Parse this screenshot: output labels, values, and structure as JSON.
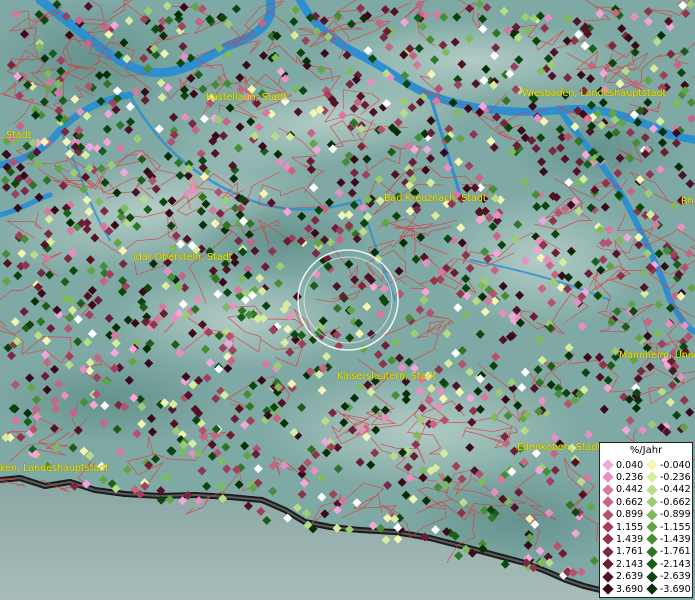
{
  "places": [
    {
      "name": "Kastellaun, Stadt",
      "pos": [
        206,
        92
      ]
    },
    {
      "name": "Wiesbaden, Landeshauptstadt",
      "pos": [
        522,
        88
      ]
    },
    {
      "name": ", Stadt",
      "pos": [
        0,
        130
      ]
    },
    {
      "name": "Bad Kreuznach, Stadt",
      "pos": [
        384,
        193
      ]
    },
    {
      "name": "Rh",
      "pos": [
        681,
        196
      ]
    },
    {
      "name": "Idar-Oberstein, Stadt",
      "pos": [
        133,
        252
      ]
    },
    {
      "name": "Mannheim, Univ",
      "pos": [
        619,
        350
      ]
    },
    {
      "name": "Kaiserslautern, Stadt",
      "pos": [
        337,
        371
      ]
    },
    {
      "name": "Edenkoben, Stadt",
      "pos": [
        517,
        442
      ]
    },
    {
      "name": "ken, Landeshauptstadt",
      "pos": [
        0,
        463
      ]
    }
  ],
  "legend": {
    "title": "%/Jahr",
    "positive": [
      {
        "value": "0.040",
        "color": "#f3a6d9"
      },
      {
        "value": "0.236",
        "color": "#e98ec0"
      },
      {
        "value": "0.442",
        "color": "#d8779f"
      },
      {
        "value": "0.662",
        "color": "#c86585"
      },
      {
        "value": "0.899",
        "color": "#b45270"
      },
      {
        "value": "1.155",
        "color": "#a0405d"
      },
      {
        "value": "1.439",
        "color": "#8e344d"
      },
      {
        "value": "1.761",
        "color": "#7a283f"
      },
      {
        "value": "2.143",
        "color": "#6a1d33"
      },
      {
        "value": "2.639",
        "color": "#521226"
      },
      {
        "value": "3.690",
        "color": "#3a0a1a"
      }
    ],
    "negative": [
      {
        "value": "-0.040",
        "color": "#f3f5b3"
      },
      {
        "value": "-0.236",
        "color": "#d6ec9e"
      },
      {
        "value": "-0.442",
        "color": "#b8dd88"
      },
      {
        "value": "-0.662",
        "color": "#9ccd73"
      },
      {
        "value": "-0.899",
        "color": "#7fba5d"
      },
      {
        "value": "-1.155",
        "color": "#62a548"
      },
      {
        "value": "-1.439",
        "color": "#468d36"
      },
      {
        "value": "-1.761",
        "color": "#2e7526"
      },
      {
        "value": "-2.143",
        "color": "#1b5e19"
      },
      {
        "value": "-2.639",
        "color": "#0c460e"
      },
      {
        "value": "-3.690",
        "color": "#052f06"
      }
    ]
  },
  "colors": {
    "terrain": "#7fa9a4",
    "river": "#2d8fd0",
    "border": "#e0383a",
    "label": "#f2e600",
    "highlight_circle": "#ffffff"
  }
}
